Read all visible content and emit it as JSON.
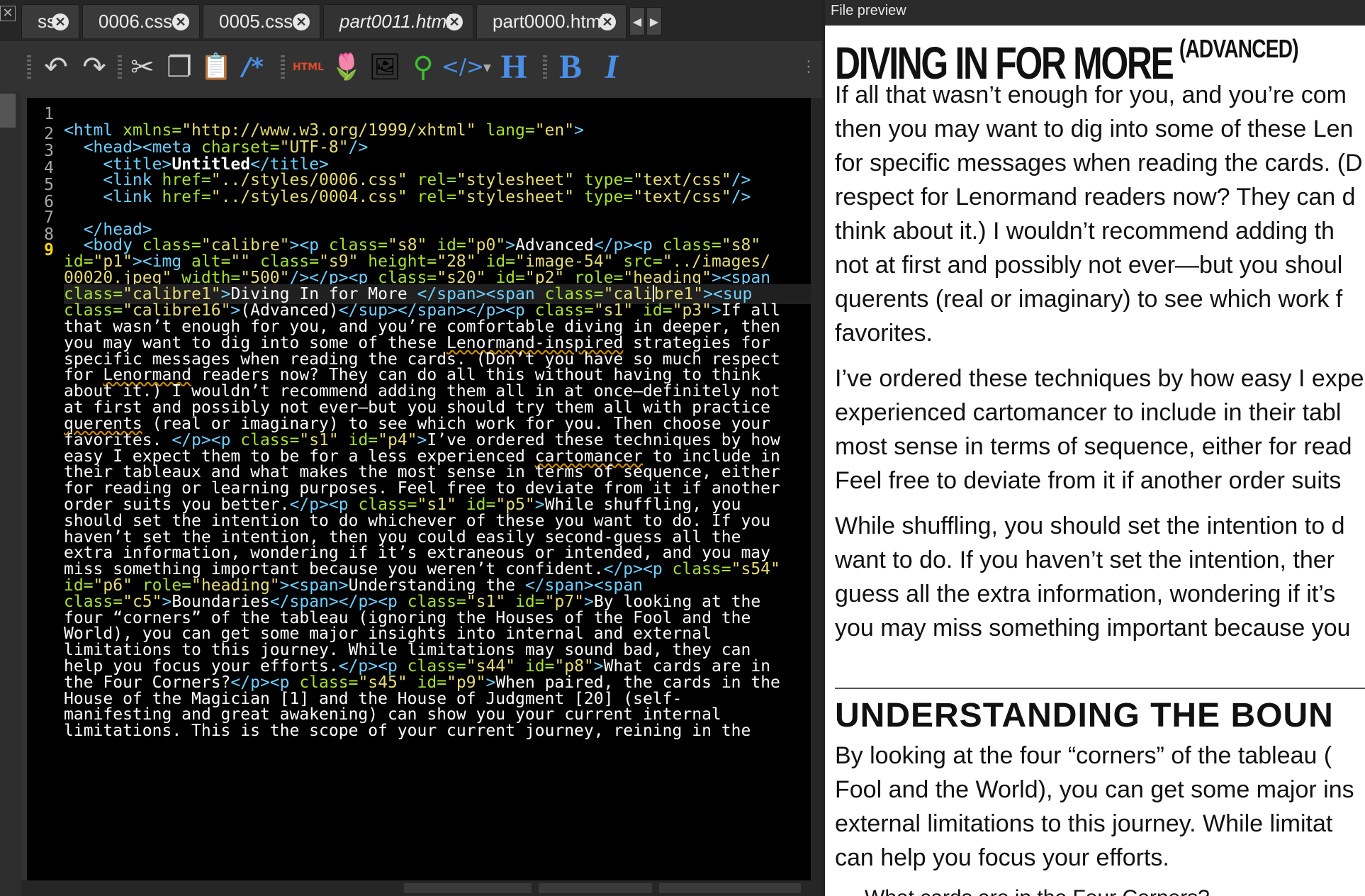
{
  "tabs": [
    {
      "label": "ss",
      "active": false
    },
    {
      "label": "0006.css",
      "active": false
    },
    {
      "label": "0005.css",
      "active": false
    },
    {
      "label": "part0011.html",
      "active": true
    },
    {
      "label": "part0000.html",
      "active": false
    }
  ],
  "tab_scroll": {
    "left": "◀",
    "right": "▶"
  },
  "close_glyph": "✕",
  "toolbar_icons": {
    "undo": "↶",
    "redo": "↷",
    "cut": "✂",
    "copy": "❐",
    "paste": "📋",
    "comment": "/*",
    "html": "HTML",
    "tulip": "🌷",
    "image": "🖼",
    "link": "⚲",
    "code": "</>",
    "heading": "H",
    "bold": "B",
    "italic": "I",
    "more": "⋮"
  },
  "line_numbers": [
    "1",
    "2",
    "3",
    "4",
    "5",
    "6",
    "7",
    "8",
    "9"
  ],
  "preview": {
    "header": "File preview",
    "title_main": "DIVING IN FOR MORE",
    "title_sup": "(ADVANCED)",
    "para1": [
      "If all that wasn’t enough for you, and you’re com",
      "then you may want to dig into some of these Len",
      "for specific messages when reading the cards. (D",
      "respect for Lenormand readers now? They can d",
      "think about it.) I wouldn’t recommend adding th",
      "not at first and possibly not ever—but you shoul",
      "querents (real or imaginary) to see which work f",
      "favorites."
    ],
    "para2": [
      "I’ve ordered these techniques by how easy I expe",
      "experienced cartomancer to include in their tabl",
      "most sense in terms of sequence, either for read",
      "Feel free to deviate from it if another order suits"
    ],
    "para3": [
      "While shuffling, you should set the intention to d",
      "want to do. If you haven’t set the intention, ther",
      "guess all the extra information, wondering if it’s",
      "you may miss something important because you"
    ],
    "heading2": "UNDERSTANDING THE BOUN",
    "para4": [
      "By looking at the four “corners” of the tableau (",
      "Fool and the World), you can get some major ins",
      "external limitations to this journey. While limitat",
      "can help you focus your efforts."
    ],
    "next_line": "What cards are in the Four Corners?"
  },
  "colors": {
    "tag": "#6fd0ff",
    "attr": "#a6e22e",
    "string": "#e6db74",
    "current_line_number": "#ffd700"
  }
}
